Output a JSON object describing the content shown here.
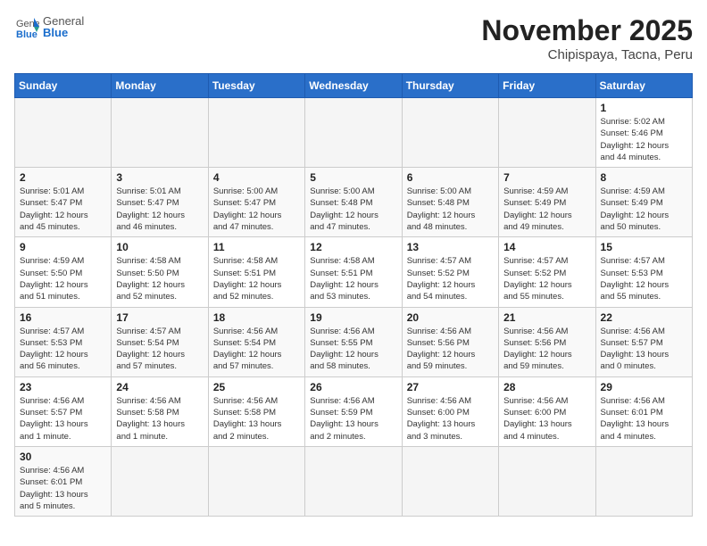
{
  "header": {
    "logo_general": "General",
    "logo_blue": "Blue",
    "month": "November 2025",
    "location": "Chipispaya, Tacna, Peru"
  },
  "weekdays": [
    "Sunday",
    "Monday",
    "Tuesday",
    "Wednesday",
    "Thursday",
    "Friday",
    "Saturday"
  ],
  "weeks": [
    [
      {
        "day": "",
        "info": ""
      },
      {
        "day": "",
        "info": ""
      },
      {
        "day": "",
        "info": ""
      },
      {
        "day": "",
        "info": ""
      },
      {
        "day": "",
        "info": ""
      },
      {
        "day": "",
        "info": ""
      },
      {
        "day": "1",
        "info": "Sunrise: 5:02 AM\nSunset: 5:46 PM\nDaylight: 12 hours\nand 44 minutes."
      }
    ],
    [
      {
        "day": "2",
        "info": "Sunrise: 5:01 AM\nSunset: 5:47 PM\nDaylight: 12 hours\nand 45 minutes."
      },
      {
        "day": "3",
        "info": "Sunrise: 5:01 AM\nSunset: 5:47 PM\nDaylight: 12 hours\nand 46 minutes."
      },
      {
        "day": "4",
        "info": "Sunrise: 5:00 AM\nSunset: 5:47 PM\nDaylight: 12 hours\nand 47 minutes."
      },
      {
        "day": "5",
        "info": "Sunrise: 5:00 AM\nSunset: 5:48 PM\nDaylight: 12 hours\nand 47 minutes."
      },
      {
        "day": "6",
        "info": "Sunrise: 5:00 AM\nSunset: 5:48 PM\nDaylight: 12 hours\nand 48 minutes."
      },
      {
        "day": "7",
        "info": "Sunrise: 4:59 AM\nSunset: 5:49 PM\nDaylight: 12 hours\nand 49 minutes."
      },
      {
        "day": "8",
        "info": "Sunrise: 4:59 AM\nSunset: 5:49 PM\nDaylight: 12 hours\nand 50 minutes."
      }
    ],
    [
      {
        "day": "9",
        "info": "Sunrise: 4:59 AM\nSunset: 5:50 PM\nDaylight: 12 hours\nand 51 minutes."
      },
      {
        "day": "10",
        "info": "Sunrise: 4:58 AM\nSunset: 5:50 PM\nDaylight: 12 hours\nand 52 minutes."
      },
      {
        "day": "11",
        "info": "Sunrise: 4:58 AM\nSunset: 5:51 PM\nDaylight: 12 hours\nand 52 minutes."
      },
      {
        "day": "12",
        "info": "Sunrise: 4:58 AM\nSunset: 5:51 PM\nDaylight: 12 hours\nand 53 minutes."
      },
      {
        "day": "13",
        "info": "Sunrise: 4:57 AM\nSunset: 5:52 PM\nDaylight: 12 hours\nand 54 minutes."
      },
      {
        "day": "14",
        "info": "Sunrise: 4:57 AM\nSunset: 5:52 PM\nDaylight: 12 hours\nand 55 minutes."
      },
      {
        "day": "15",
        "info": "Sunrise: 4:57 AM\nSunset: 5:53 PM\nDaylight: 12 hours\nand 55 minutes."
      }
    ],
    [
      {
        "day": "16",
        "info": "Sunrise: 4:57 AM\nSunset: 5:53 PM\nDaylight: 12 hours\nand 56 minutes."
      },
      {
        "day": "17",
        "info": "Sunrise: 4:57 AM\nSunset: 5:54 PM\nDaylight: 12 hours\nand 57 minutes."
      },
      {
        "day": "18",
        "info": "Sunrise: 4:56 AM\nSunset: 5:54 PM\nDaylight: 12 hours\nand 57 minutes."
      },
      {
        "day": "19",
        "info": "Sunrise: 4:56 AM\nSunset: 5:55 PM\nDaylight: 12 hours\nand 58 minutes."
      },
      {
        "day": "20",
        "info": "Sunrise: 4:56 AM\nSunset: 5:56 PM\nDaylight: 12 hours\nand 59 minutes."
      },
      {
        "day": "21",
        "info": "Sunrise: 4:56 AM\nSunset: 5:56 PM\nDaylight: 12 hours\nand 59 minutes."
      },
      {
        "day": "22",
        "info": "Sunrise: 4:56 AM\nSunset: 5:57 PM\nDaylight: 13 hours\nand 0 minutes."
      }
    ],
    [
      {
        "day": "23",
        "info": "Sunrise: 4:56 AM\nSunset: 5:57 PM\nDaylight: 13 hours\nand 1 minute."
      },
      {
        "day": "24",
        "info": "Sunrise: 4:56 AM\nSunset: 5:58 PM\nDaylight: 13 hours\nand 1 minute."
      },
      {
        "day": "25",
        "info": "Sunrise: 4:56 AM\nSunset: 5:58 PM\nDaylight: 13 hours\nand 2 minutes."
      },
      {
        "day": "26",
        "info": "Sunrise: 4:56 AM\nSunset: 5:59 PM\nDaylight: 13 hours\nand 2 minutes."
      },
      {
        "day": "27",
        "info": "Sunrise: 4:56 AM\nSunset: 6:00 PM\nDaylight: 13 hours\nand 3 minutes."
      },
      {
        "day": "28",
        "info": "Sunrise: 4:56 AM\nSunset: 6:00 PM\nDaylight: 13 hours\nand 4 minutes."
      },
      {
        "day": "29",
        "info": "Sunrise: 4:56 AM\nSunset: 6:01 PM\nDaylight: 13 hours\nand 4 minutes."
      }
    ],
    [
      {
        "day": "30",
        "info": "Sunrise: 4:56 AM\nSunset: 6:01 PM\nDaylight: 13 hours\nand 5 minutes."
      },
      {
        "day": "",
        "info": ""
      },
      {
        "day": "",
        "info": ""
      },
      {
        "day": "",
        "info": ""
      },
      {
        "day": "",
        "info": ""
      },
      {
        "day": "",
        "info": ""
      },
      {
        "day": "",
        "info": ""
      }
    ]
  ]
}
